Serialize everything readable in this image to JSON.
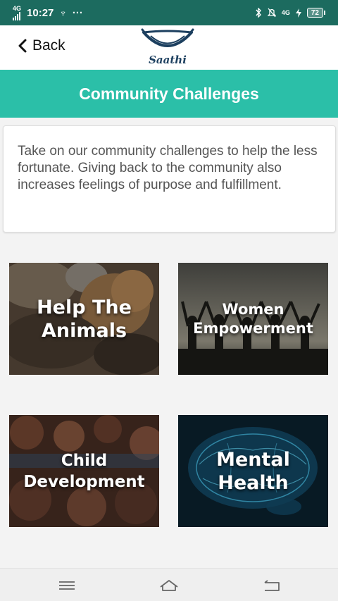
{
  "status_bar": {
    "network": "4G",
    "time": "10:27",
    "usb_symbol": "♆",
    "more": "···",
    "right_network": "4G",
    "battery": "72"
  },
  "header": {
    "back_label": "Back",
    "logo_text": "Saathi"
  },
  "page_title": "Community Challenges",
  "intro": {
    "text": "Take on our community challenges to help the less fortunate. Giving back to the community also increases feelings of purpose and fulfillment."
  },
  "challenges": [
    {
      "line1": "Help The",
      "line2": "Animals"
    },
    {
      "line1": "Women",
      "line2": "Empowerment"
    },
    {
      "line1": "Child",
      "line2": "Development"
    },
    {
      "line1": "Mental",
      "line2": "Health"
    }
  ],
  "colors": {
    "status_bar": "#1c6b5f",
    "accent": "#2bbfa8",
    "logo": "#1c3f5f"
  },
  "icons": {
    "back": "chevron-left-icon",
    "nav_menu": "menu-icon",
    "nav_home": "home-icon",
    "nav_back": "return-icon"
  }
}
